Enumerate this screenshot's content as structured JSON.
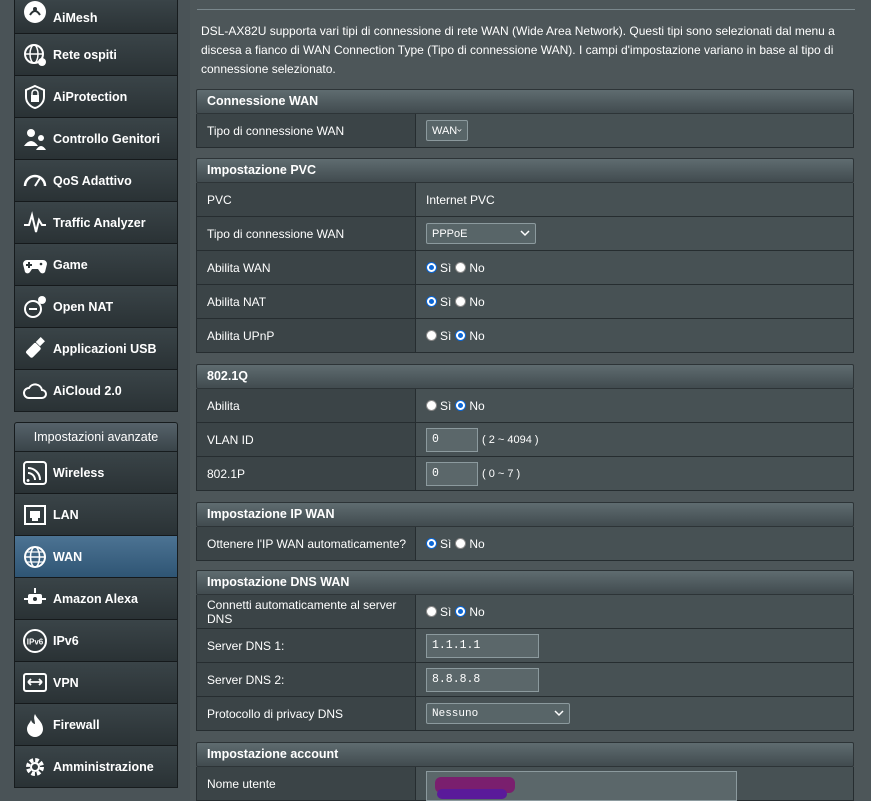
{
  "sidebar": {
    "general": [
      {
        "label": "AiMesh",
        "icon": "aimesh-icon"
      },
      {
        "label": "Rete ospiti",
        "icon": "guest-network-icon"
      },
      {
        "label": "AiProtection",
        "icon": "shield-icon"
      },
      {
        "label": "Controllo Genitori",
        "icon": "parental-control-icon"
      },
      {
        "label": "QoS Adattivo",
        "icon": "gauge-icon"
      },
      {
        "label": "Traffic Analyzer",
        "icon": "traffic-analyzer-icon"
      },
      {
        "label": "Game",
        "icon": "gamepad-icon"
      },
      {
        "label": "Open NAT",
        "icon": "open-nat-icon"
      },
      {
        "label": "Applicazioni USB",
        "icon": "usb-icon"
      },
      {
        "label": "AiCloud 2.0",
        "icon": "cloud-icon"
      }
    ],
    "advanced_header": "Impostazioni avanzate",
    "advanced": [
      {
        "label": "Wireless",
        "icon": "wireless-icon"
      },
      {
        "label": "LAN",
        "icon": "lan-icon"
      },
      {
        "label": "WAN",
        "icon": "globe-icon",
        "active": true
      },
      {
        "label": "Amazon Alexa",
        "icon": "alexa-icon"
      },
      {
        "label": "IPv6",
        "icon": "ipv6-icon"
      },
      {
        "label": "VPN",
        "icon": "vpn-icon"
      },
      {
        "label": "Firewall",
        "icon": "firewall-icon"
      },
      {
        "label": "Amministrazione",
        "icon": "gear-icon"
      }
    ]
  },
  "intro": "DSL-AX82U supporta vari tipi di connessione di rete WAN (Wide Area Network). Questi tipi sono selezionati dal menu a discesa a fianco di WAN Connection Type (Tipo di connessione WAN). I campi d'impostazione variano in base al tipo di connessione selezionato.",
  "wan_connection": {
    "title": "Connessione WAN",
    "type_label": "Tipo di connessione WAN",
    "type_value": "WAN"
  },
  "pvc": {
    "title": "Impostazione PVC",
    "pvc_label": "PVC",
    "pvc_value": "Internet PVC",
    "conn_type_label": "Tipo di connessione WAN",
    "conn_type_value": "PPPoE",
    "enable_wan_label": "Abilita WAN",
    "enable_nat_label": "Abilita NAT",
    "enable_upnp_label": "Abilita UPnP"
  },
  "q8021": {
    "title": "802.1Q",
    "enable_label": "Abilita",
    "vlan_label": "VLAN ID",
    "vlan_value": "0",
    "vlan_hint": "( 2 ~ 4094 )",
    "p_label": "802.1P",
    "p_value": "0",
    "p_hint": "( 0 ~ 7 )"
  },
  "ip_wan": {
    "title": "Impostazione IP WAN",
    "auto_label": "Ottenere l'IP WAN automaticamente?"
  },
  "dns_wan": {
    "title": "Impostazione DNS WAN",
    "auto_label": "Connetti automaticamente al server DNS",
    "dns1_label": "Server DNS 1:",
    "dns1_value": "1.1.1.1",
    "dns2_label": "Server DNS 2:",
    "dns2_value": "8.8.8.8",
    "privacy_label": "Protocollo di privacy DNS",
    "privacy_value": "Nessuno"
  },
  "account": {
    "title": "Impostazione account",
    "user_label": "Nome utente"
  },
  "radio": {
    "yes": "Sì",
    "no": "No"
  },
  "colors": {
    "active_menu": "#3e6685",
    "radio_selected": "#0a66d6",
    "redaction": "#6a1a8a"
  }
}
